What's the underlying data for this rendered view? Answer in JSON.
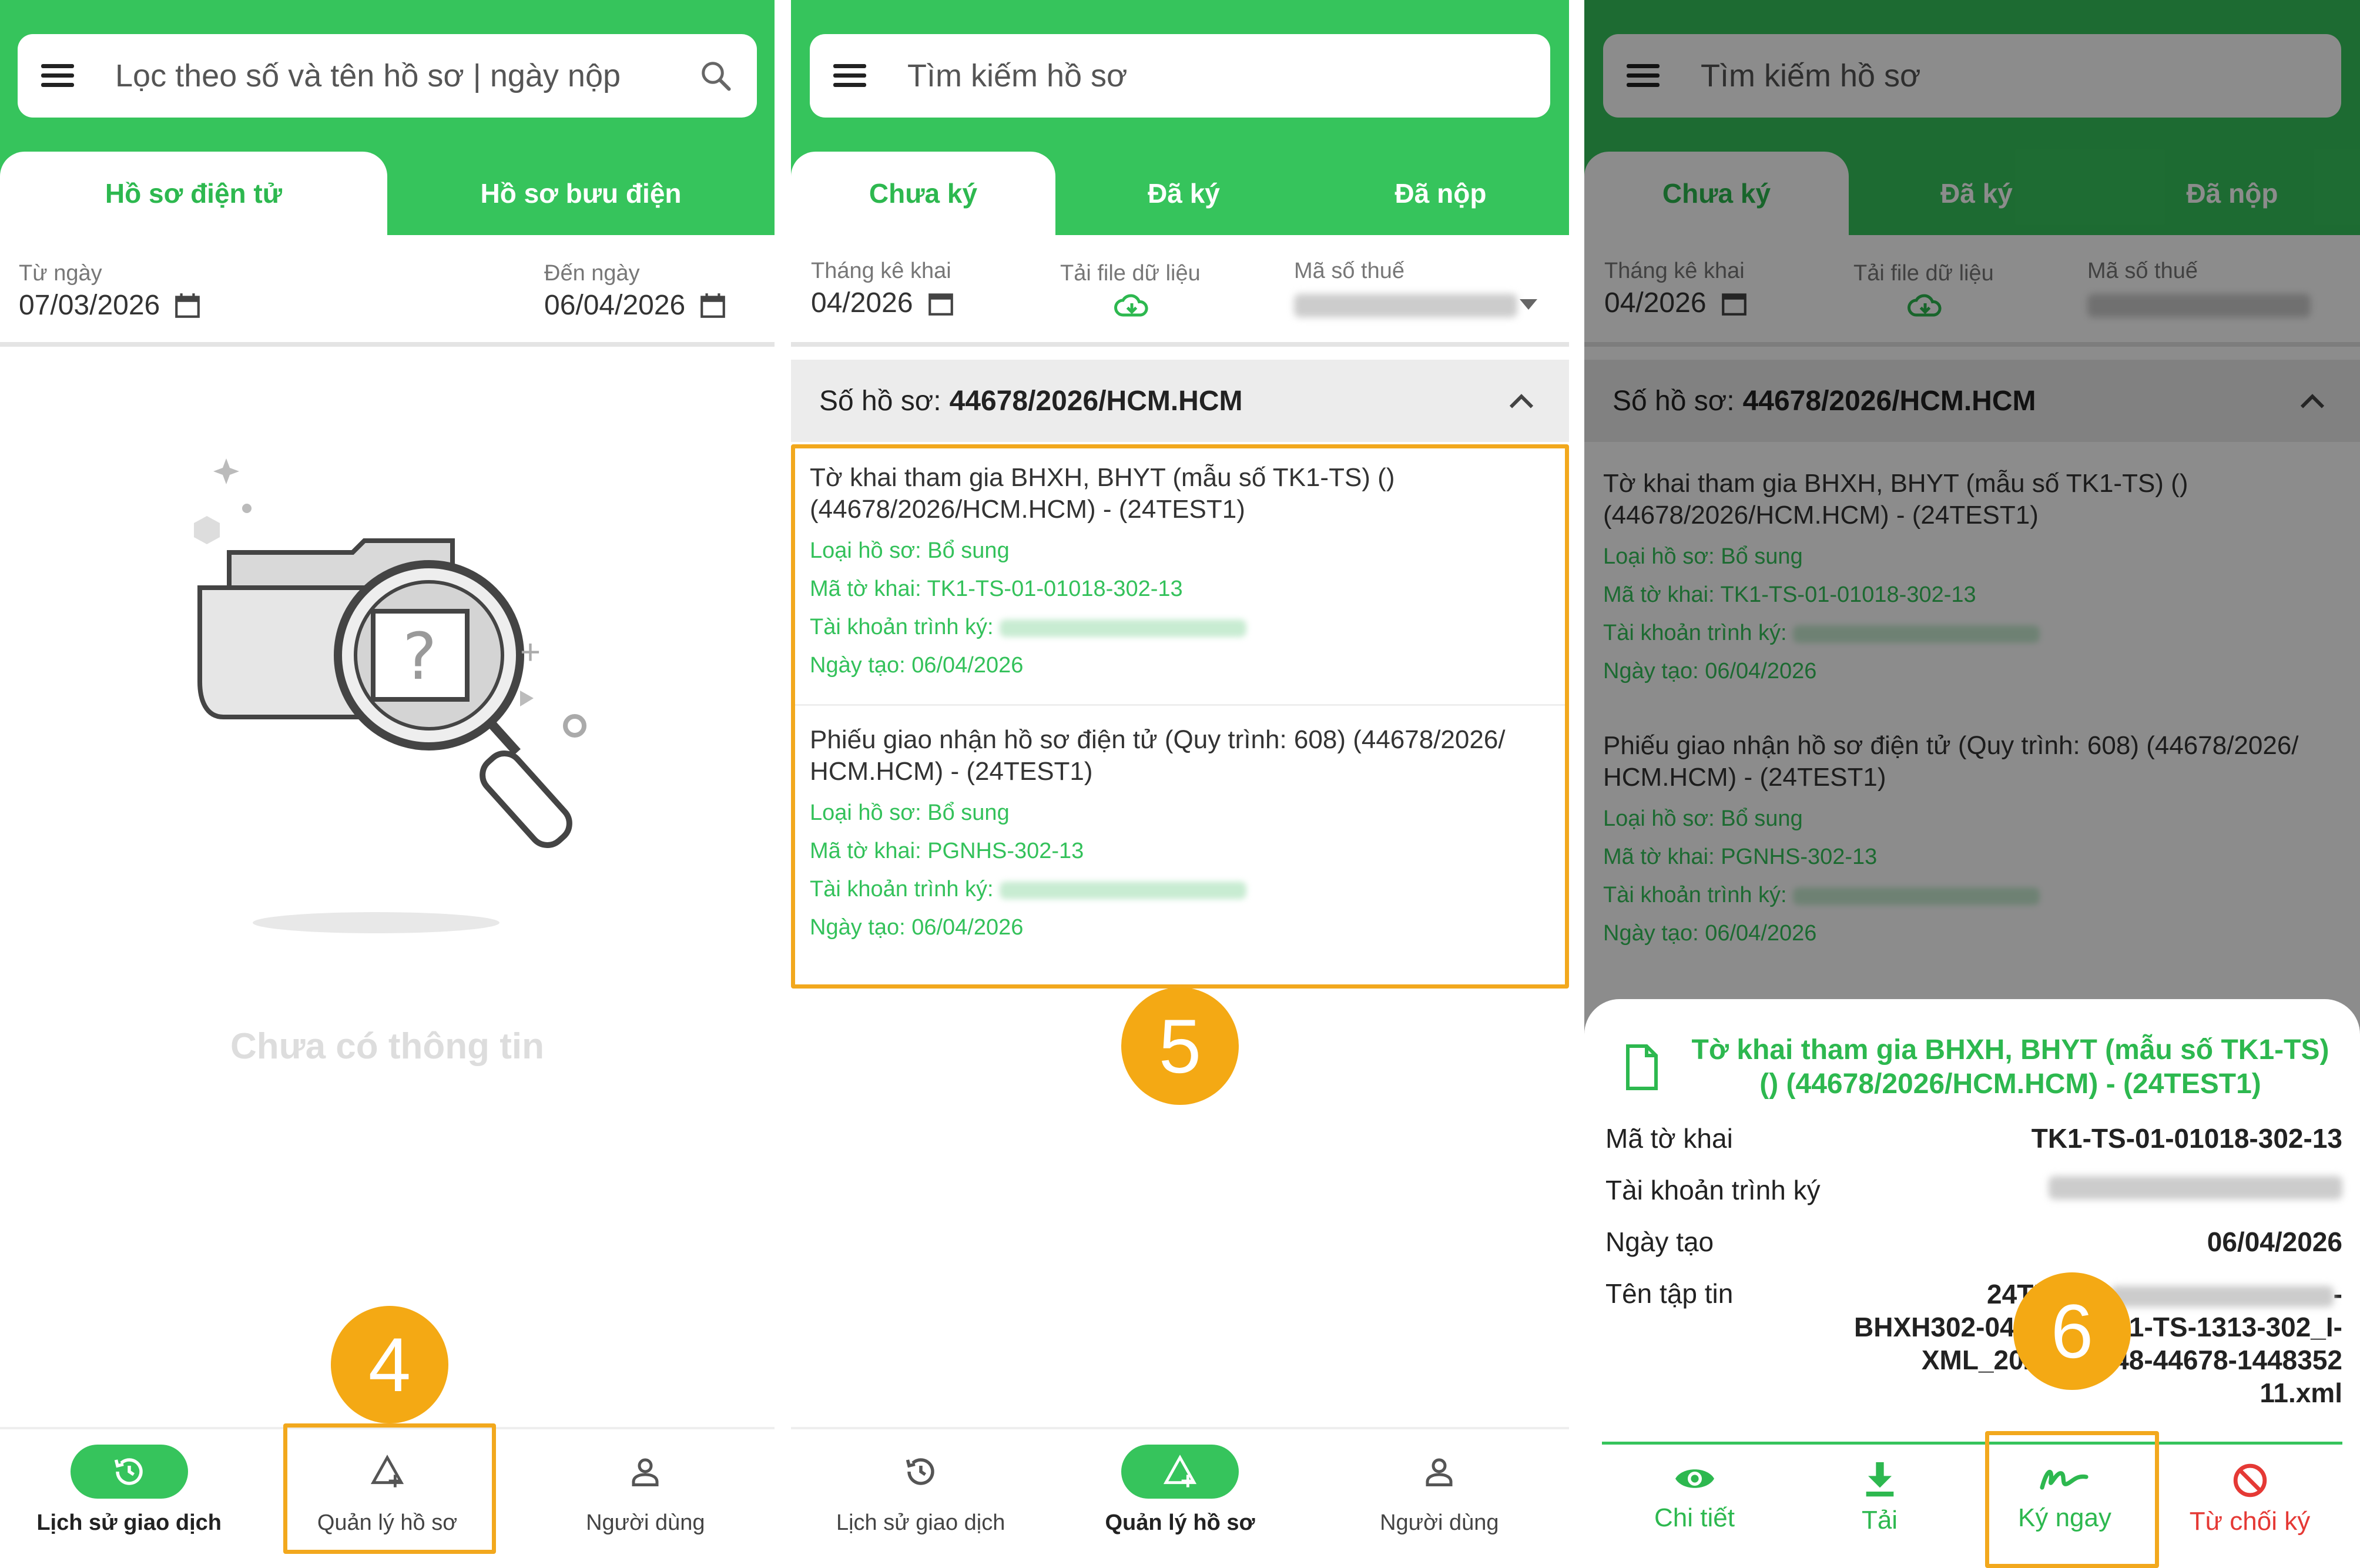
{
  "panel1": {
    "search_placeholder": "Lọc theo số và tên hồ sơ | ngày nộp",
    "tabs": [
      "Hồ sơ điện tử",
      "Hồ sơ bưu điện"
    ],
    "from_label": "Từ ngày",
    "from_value": "07/03/2026",
    "to_label": "Đến ngày",
    "to_value": "06/04/2026",
    "empty_text": "Chưa có thông tin",
    "nav": [
      "Lịch sử giao dịch",
      "Quản lý hồ sơ",
      "Người dùng"
    ],
    "step": "4"
  },
  "panel2": {
    "search_placeholder": "Tìm kiếm hồ sơ",
    "tabs": [
      "Chưa ký",
      "Đã ký",
      "Đã nộp"
    ],
    "month_label": "Tháng kê khai",
    "month_value": "04/2026",
    "download_label": "Tải file dữ liệu",
    "tax_label": "Mã số thuế",
    "section_prefix": "Số hồ sơ:",
    "section_id": "44678/2026/HCM.HCM",
    "docs": [
      {
        "title": "Tờ khai tham gia BHXH, BHYT (mẫu số TK1-TS) () (44678/2026/HCM.HCM) - (24TEST1)",
        "type": "Loại hồ sơ:  Bổ sung",
        "code": "Mã tờ khai: TK1-TS-01-01018-302-13",
        "account": "Tài khoản trình ký:",
        "created": "Ngày tạo: 06/04/2026"
      },
      {
        "title": "Phiếu giao nhận hồ sơ điện tử (Quy trình: 608) (44678/2026/ HCM.HCM) - (24TEST1)",
        "type": "Loại hồ sơ:  Bổ sung",
        "code": "Mã tờ khai: PGNHS-302-13",
        "account": "Tài khoản trình ký:",
        "created": "Ngày tạo: 06/04/2026"
      }
    ],
    "nav": [
      "Lịch sử giao dịch",
      "Quản lý hồ sơ",
      "Người dùng"
    ],
    "step": "5"
  },
  "panel3": {
    "search_placeholder": "Tìm kiếm hồ sơ",
    "tabs": [
      "Chưa ký",
      "Đã ký",
      "Đã nộp"
    ],
    "month_label": "Tháng kê khai",
    "month_value": "04/2026",
    "download_label": "Tải file dữ liệu",
    "tax_label": "Mã số thuế",
    "section_prefix": "Số hồ sơ:",
    "section_id": "44678/2026/HCM.HCM",
    "docs": [
      {
        "title": "Tờ khai tham gia BHXH, BHYT (mẫu số TK1-TS) () (44678/2026/HCM.HCM) - (24TEST1)",
        "type": "Loại hồ sơ:  Bổ sung",
        "code": "Mã tờ khai: TK1-TS-01-01018-302-13",
        "account": "Tài khoản trình ký:",
        "created": "Ngày tạo: 06/04/2026"
      },
      {
        "title": "Phiếu giao nhận hồ sơ điện tử (Quy trình: 608) (44678/2026/ HCM.HCM) - (24TEST1)",
        "type": "Loại hồ sơ:  Bổ sung",
        "code": "Mã tờ khai: PGNHS-302-13",
        "account": "Tài khoản trình ký:",
        "created": "Ngày tạo: 06/04/2026"
      }
    ],
    "sheet": {
      "title": "Tờ khai tham gia BHXH, BHYT (mẫu số TK1-TS) () (44678/2026/HCM.HCM) - (24TEST1)",
      "code_label": "Mã tờ khai",
      "code_value": "TK1-TS-01-01018-302-13",
      "account_label": "Tài khoản trình ký",
      "created_label": "Ngày tạo",
      "created_value": "06/04/2026",
      "file_label": "Tên tập tin",
      "file_line1": "24TEST1-",
      "file_line2": "BHXH302-04-2026-TK1-TS-1313-302_I-",
      "file_line3": "XML_2026461448-44678-1448352",
      "file_line4": "11.xml",
      "actions": [
        "Chi tiết",
        "Tải",
        "Ký ngay",
        "Từ chối ký"
      ]
    },
    "step": "6"
  },
  "colors": {
    "green": "#36c45c",
    "green_text": "#2db84f",
    "orange": "#f4a914",
    "red": "#e53935"
  }
}
